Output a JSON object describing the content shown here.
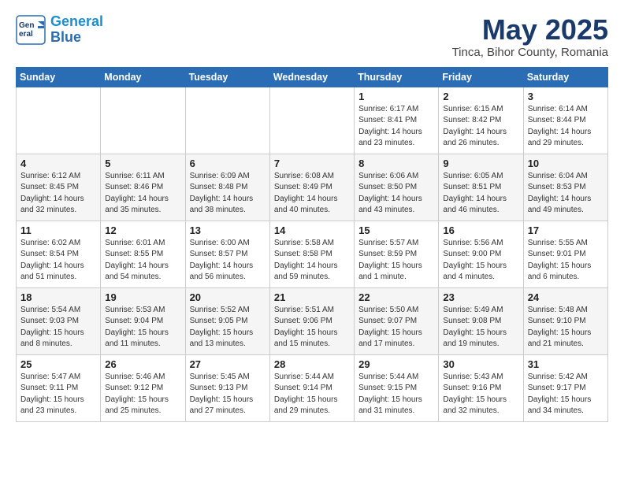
{
  "header": {
    "logo_line1": "General",
    "logo_line2": "Blue",
    "title": "May 2025",
    "subtitle": "Tinca, Bihor County, Romania"
  },
  "weekdays": [
    "Sunday",
    "Monday",
    "Tuesday",
    "Wednesday",
    "Thursday",
    "Friday",
    "Saturday"
  ],
  "weeks": [
    [
      {
        "day": "",
        "info": ""
      },
      {
        "day": "",
        "info": ""
      },
      {
        "day": "",
        "info": ""
      },
      {
        "day": "",
        "info": ""
      },
      {
        "day": "1",
        "info": "Sunrise: 6:17 AM\nSunset: 8:41 PM\nDaylight: 14 hours\nand 23 minutes."
      },
      {
        "day": "2",
        "info": "Sunrise: 6:15 AM\nSunset: 8:42 PM\nDaylight: 14 hours\nand 26 minutes."
      },
      {
        "day": "3",
        "info": "Sunrise: 6:14 AM\nSunset: 8:44 PM\nDaylight: 14 hours\nand 29 minutes."
      }
    ],
    [
      {
        "day": "4",
        "info": "Sunrise: 6:12 AM\nSunset: 8:45 PM\nDaylight: 14 hours\nand 32 minutes."
      },
      {
        "day": "5",
        "info": "Sunrise: 6:11 AM\nSunset: 8:46 PM\nDaylight: 14 hours\nand 35 minutes."
      },
      {
        "day": "6",
        "info": "Sunrise: 6:09 AM\nSunset: 8:48 PM\nDaylight: 14 hours\nand 38 minutes."
      },
      {
        "day": "7",
        "info": "Sunrise: 6:08 AM\nSunset: 8:49 PM\nDaylight: 14 hours\nand 40 minutes."
      },
      {
        "day": "8",
        "info": "Sunrise: 6:06 AM\nSunset: 8:50 PM\nDaylight: 14 hours\nand 43 minutes."
      },
      {
        "day": "9",
        "info": "Sunrise: 6:05 AM\nSunset: 8:51 PM\nDaylight: 14 hours\nand 46 minutes."
      },
      {
        "day": "10",
        "info": "Sunrise: 6:04 AM\nSunset: 8:53 PM\nDaylight: 14 hours\nand 49 minutes."
      }
    ],
    [
      {
        "day": "11",
        "info": "Sunrise: 6:02 AM\nSunset: 8:54 PM\nDaylight: 14 hours\nand 51 minutes."
      },
      {
        "day": "12",
        "info": "Sunrise: 6:01 AM\nSunset: 8:55 PM\nDaylight: 14 hours\nand 54 minutes."
      },
      {
        "day": "13",
        "info": "Sunrise: 6:00 AM\nSunset: 8:57 PM\nDaylight: 14 hours\nand 56 minutes."
      },
      {
        "day": "14",
        "info": "Sunrise: 5:58 AM\nSunset: 8:58 PM\nDaylight: 14 hours\nand 59 minutes."
      },
      {
        "day": "15",
        "info": "Sunrise: 5:57 AM\nSunset: 8:59 PM\nDaylight: 15 hours\nand 1 minute."
      },
      {
        "day": "16",
        "info": "Sunrise: 5:56 AM\nSunset: 9:00 PM\nDaylight: 15 hours\nand 4 minutes."
      },
      {
        "day": "17",
        "info": "Sunrise: 5:55 AM\nSunset: 9:01 PM\nDaylight: 15 hours\nand 6 minutes."
      }
    ],
    [
      {
        "day": "18",
        "info": "Sunrise: 5:54 AM\nSunset: 9:03 PM\nDaylight: 15 hours\nand 8 minutes."
      },
      {
        "day": "19",
        "info": "Sunrise: 5:53 AM\nSunset: 9:04 PM\nDaylight: 15 hours\nand 11 minutes."
      },
      {
        "day": "20",
        "info": "Sunrise: 5:52 AM\nSunset: 9:05 PM\nDaylight: 15 hours\nand 13 minutes."
      },
      {
        "day": "21",
        "info": "Sunrise: 5:51 AM\nSunset: 9:06 PM\nDaylight: 15 hours\nand 15 minutes."
      },
      {
        "day": "22",
        "info": "Sunrise: 5:50 AM\nSunset: 9:07 PM\nDaylight: 15 hours\nand 17 minutes."
      },
      {
        "day": "23",
        "info": "Sunrise: 5:49 AM\nSunset: 9:08 PM\nDaylight: 15 hours\nand 19 minutes."
      },
      {
        "day": "24",
        "info": "Sunrise: 5:48 AM\nSunset: 9:10 PM\nDaylight: 15 hours\nand 21 minutes."
      }
    ],
    [
      {
        "day": "25",
        "info": "Sunrise: 5:47 AM\nSunset: 9:11 PM\nDaylight: 15 hours\nand 23 minutes."
      },
      {
        "day": "26",
        "info": "Sunrise: 5:46 AM\nSunset: 9:12 PM\nDaylight: 15 hours\nand 25 minutes."
      },
      {
        "day": "27",
        "info": "Sunrise: 5:45 AM\nSunset: 9:13 PM\nDaylight: 15 hours\nand 27 minutes."
      },
      {
        "day": "28",
        "info": "Sunrise: 5:44 AM\nSunset: 9:14 PM\nDaylight: 15 hours\nand 29 minutes."
      },
      {
        "day": "29",
        "info": "Sunrise: 5:44 AM\nSunset: 9:15 PM\nDaylight: 15 hours\nand 31 minutes."
      },
      {
        "day": "30",
        "info": "Sunrise: 5:43 AM\nSunset: 9:16 PM\nDaylight: 15 hours\nand 32 minutes."
      },
      {
        "day": "31",
        "info": "Sunrise: 5:42 AM\nSunset: 9:17 PM\nDaylight: 15 hours\nand 34 minutes."
      }
    ]
  ]
}
